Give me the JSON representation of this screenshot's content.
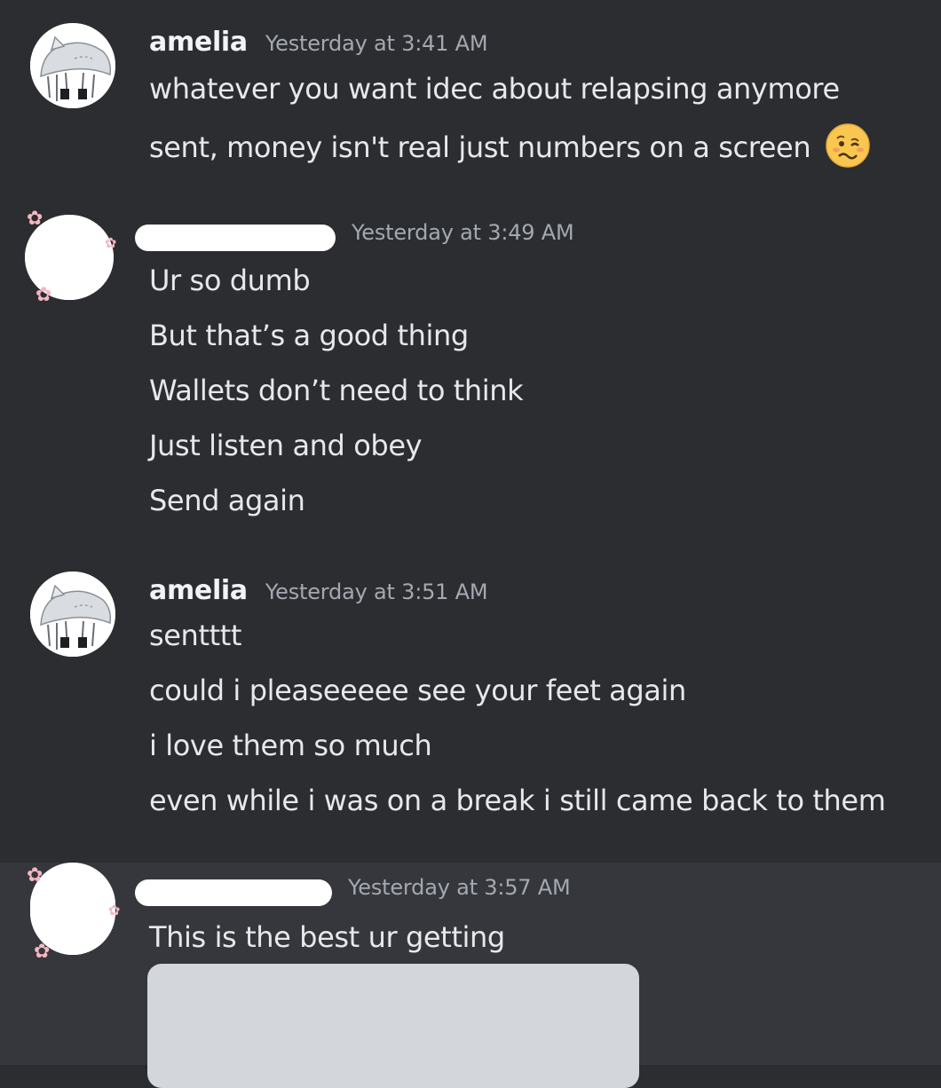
{
  "messages": [
    {
      "author": "amelia",
      "timestamp": "Yesterday at 3:41 AM",
      "avatar_icon": "cat-girl-avatar-icon",
      "lines": [
        "whatever you want idec about relapsing anymore",
        "sent, money isn't real just numbers on a screen"
      ],
      "emoji": "woozy-face-icon"
    },
    {
      "author": "",
      "author_redacted": true,
      "timestamp": "Yesterday at 3:49 AM",
      "avatar_icon": "redacted-avatar-icon",
      "lines": [
        "Ur so dumb",
        "But that’s a good thing",
        "Wallets don’t need to think",
        "Just listen and obey",
        "Send again"
      ]
    },
    {
      "author": "amelia",
      "timestamp": "Yesterday at 3:51 AM",
      "avatar_icon": "cat-girl-avatar-icon",
      "lines": [
        "sentttt",
        "could i pleaseeeee see your feet again",
        "i love them so much",
        "even while i was on a break i still came back to them"
      ]
    },
    {
      "author": "",
      "author_redacted": true,
      "timestamp": "Yesterday at 3:57 AM",
      "avatar_icon": "redacted-avatar-icon",
      "lines": [
        "This is the best ur getting"
      ],
      "attachment": "image-attachment"
    }
  ],
  "colors": {
    "background": "#2b2d31",
    "hover_background": "#35373c",
    "username": "#f2f3f5",
    "timestamp": "#a4a8b0",
    "text": "#dbdee1",
    "attachment": "#d3d6da"
  }
}
